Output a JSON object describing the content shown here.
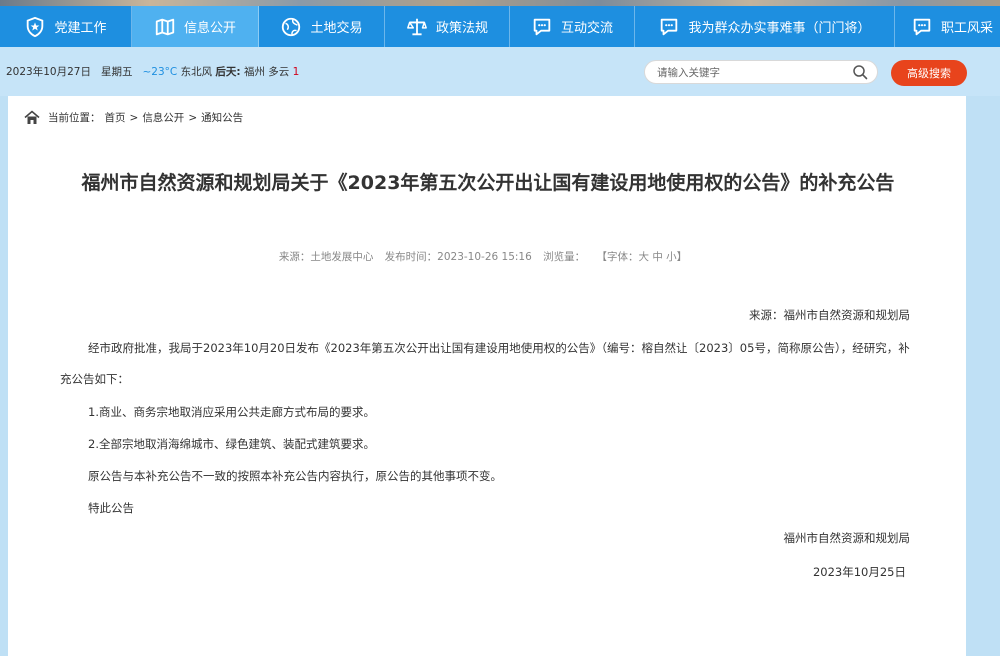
{
  "nav": {
    "items": [
      {
        "label": "党建工作",
        "icon": "shield-star-icon"
      },
      {
        "label": "信息公开",
        "icon": "map-icon",
        "active": true
      },
      {
        "label": "土地交易",
        "icon": "globe-icon"
      },
      {
        "label": "政策法规",
        "icon": "scales-icon"
      },
      {
        "label": "互动交流",
        "icon": "chat-icon"
      },
      {
        "label": "我为群众办实事难事（门门将）",
        "icon": "chat-icon"
      },
      {
        "label": "职工风采",
        "icon": "chat-icon"
      }
    ]
  },
  "infobar": {
    "date": "2023年10月27日",
    "weekday": "星期五",
    "temp": "~23°C",
    "wind": "东北风",
    "aqi_label": "后天:",
    "weather": "福州 多云",
    "aqi_value": "1",
    "search_placeholder": "请输入关键字",
    "advanced_search": "高级搜索"
  },
  "breadcrumb": {
    "prefix": "当前位置：",
    "items": [
      "首页",
      "信息公开",
      "通知公告"
    ],
    "separator": ">"
  },
  "article": {
    "title": "福州市自然资源和规划局关于《2023年第五次公开出让国有建设用地使用权的公告》的补充公告",
    "meta_source": "来源：土地发展中心",
    "meta_time": "发布时间：2023-10-26 15:16",
    "meta_views": "浏览量：",
    "meta_font": "【字体：大 中 小】",
    "source_line": "来源：福州市自然资源和规划局",
    "p1": "经市政府批准，我局于2023年10月20日发布《2023年第五次公开出让国有建设用地使用权的公告》（编号：榕自然让〔2023〕05号，简称原公告），经研究，补充公告如下：",
    "p2": "1.商业、商务宗地取消应采用公共走廊方式布局的要求。",
    "p3": "2.全部宗地取消海绵城市、绿色建筑、装配式建筑要求。",
    "p4": "原公告与本补充公告不一致的按照本补充公告内容执行，原公告的其他事项不变。",
    "p5": "特此公告",
    "sign_org": "福州市自然资源和规划局",
    "sign_date": "2023年10月25日"
  },
  "colors": {
    "nav_bg": "#1e8fe0",
    "nav_active": "#4fb1f0",
    "page_bg": "#bfe0f5",
    "advanced_button": "#e8441c"
  }
}
